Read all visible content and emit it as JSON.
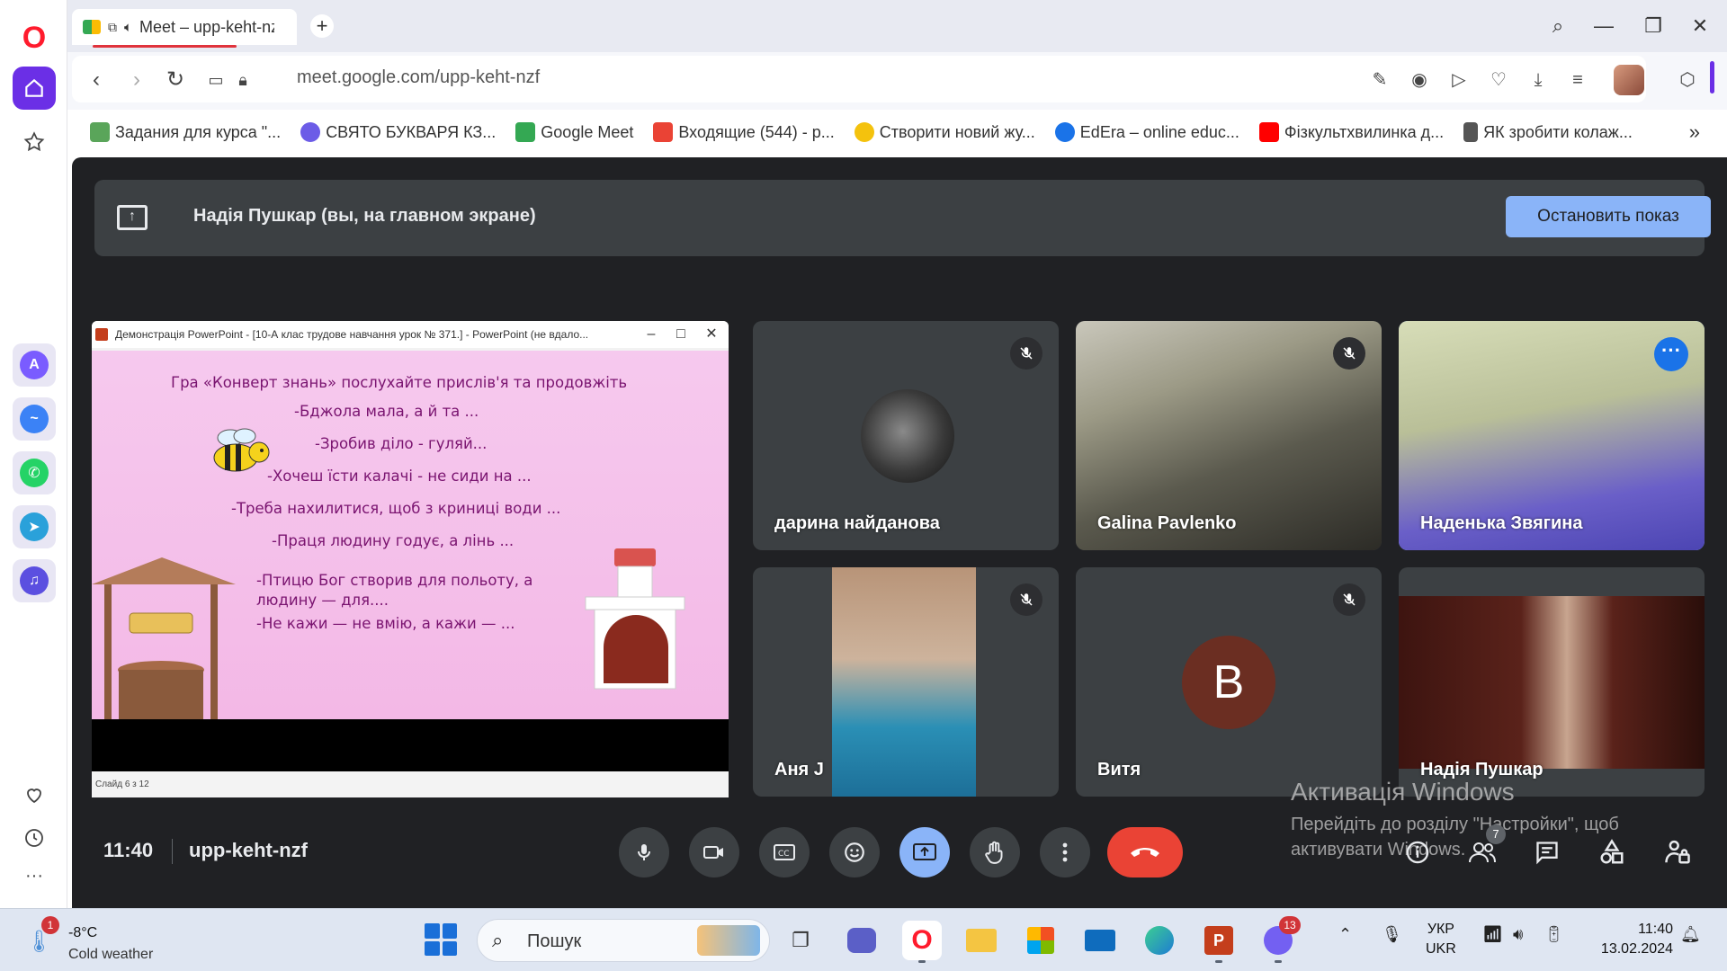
{
  "browser": {
    "tab_title": "Meet – upp-keht-nzf",
    "url": "meet.google.com/upp-keht-nzf",
    "bookmarks": [
      {
        "label": "Задания для курса \"...",
        "color": "#5aa55a"
      },
      {
        "label": "СВЯТО БУКВАРЯ КЗ...",
        "color": "#6c5ce7"
      },
      {
        "label": "Google Meet",
        "color": "#34a853"
      },
      {
        "label": "Входящие (544) - p...",
        "color": "#ea4335"
      },
      {
        "label": "Створити новий жу...",
        "color": "#f4c20d"
      },
      {
        "label": "EdEra – online educ...",
        "color": "#1a73e8"
      },
      {
        "label": "Фізкультхвилинка д...",
        "color": "#ff0000"
      },
      {
        "label": "ЯК зробити колаж...",
        "color": "#555555"
      }
    ]
  },
  "meet": {
    "banner_text": "Надія Пушкар (вы, на главном экране)",
    "stop_button": "Остановить показ",
    "clock": "11:40",
    "meeting_code": "upp-keht-nzf",
    "participants_count": "7",
    "participants": [
      {
        "name": "дарина найданова"
      },
      {
        "name": "Galina Pavlenko"
      },
      {
        "name": "Наденька Звягина"
      },
      {
        "name": "Аня J"
      },
      {
        "name": "Витя",
        "initial": "B"
      },
      {
        "name": "Надія Пушкар"
      }
    ],
    "accent": "#8ab4f8",
    "end_call_color": "#ea4335"
  },
  "presentation": {
    "window_title": "Демонстрація PowerPoint - [10-А клас трудове навчання урок № 371.] - PowerPoint (не вдало...",
    "status": "Слайд 6 з 12",
    "slide_lines": [
      "Гра «Конверт знань»  послухайте прислів'я та продовжіть",
      "-Бджола мала, а й та ...",
      "-Зробив діло - гуляй...",
      "-Хочеш їсти калачі - не сиди на ...",
      "-Треба нахилитися, щоб з криниці води ...",
      "-Праця людину годує, а лінь ...",
      "-Птицю Бог створив для польоту, а",
      "людину — для....",
      "-Не кажи — не вмію, а кажи — ..."
    ]
  },
  "watermark": {
    "title": "Активація Windows",
    "line1": "Перейдіть до розділу \"Настройки\", щоб",
    "line2": "активувати Windows."
  },
  "taskbar": {
    "temperature": "-8°C",
    "weather": "Cold weather",
    "weather_badge": "1",
    "search": "Пошук",
    "viber_badge": "13",
    "lang_top": "УКР",
    "lang_bottom": "UKR",
    "time": "11:40",
    "date": "13.02.2024"
  }
}
